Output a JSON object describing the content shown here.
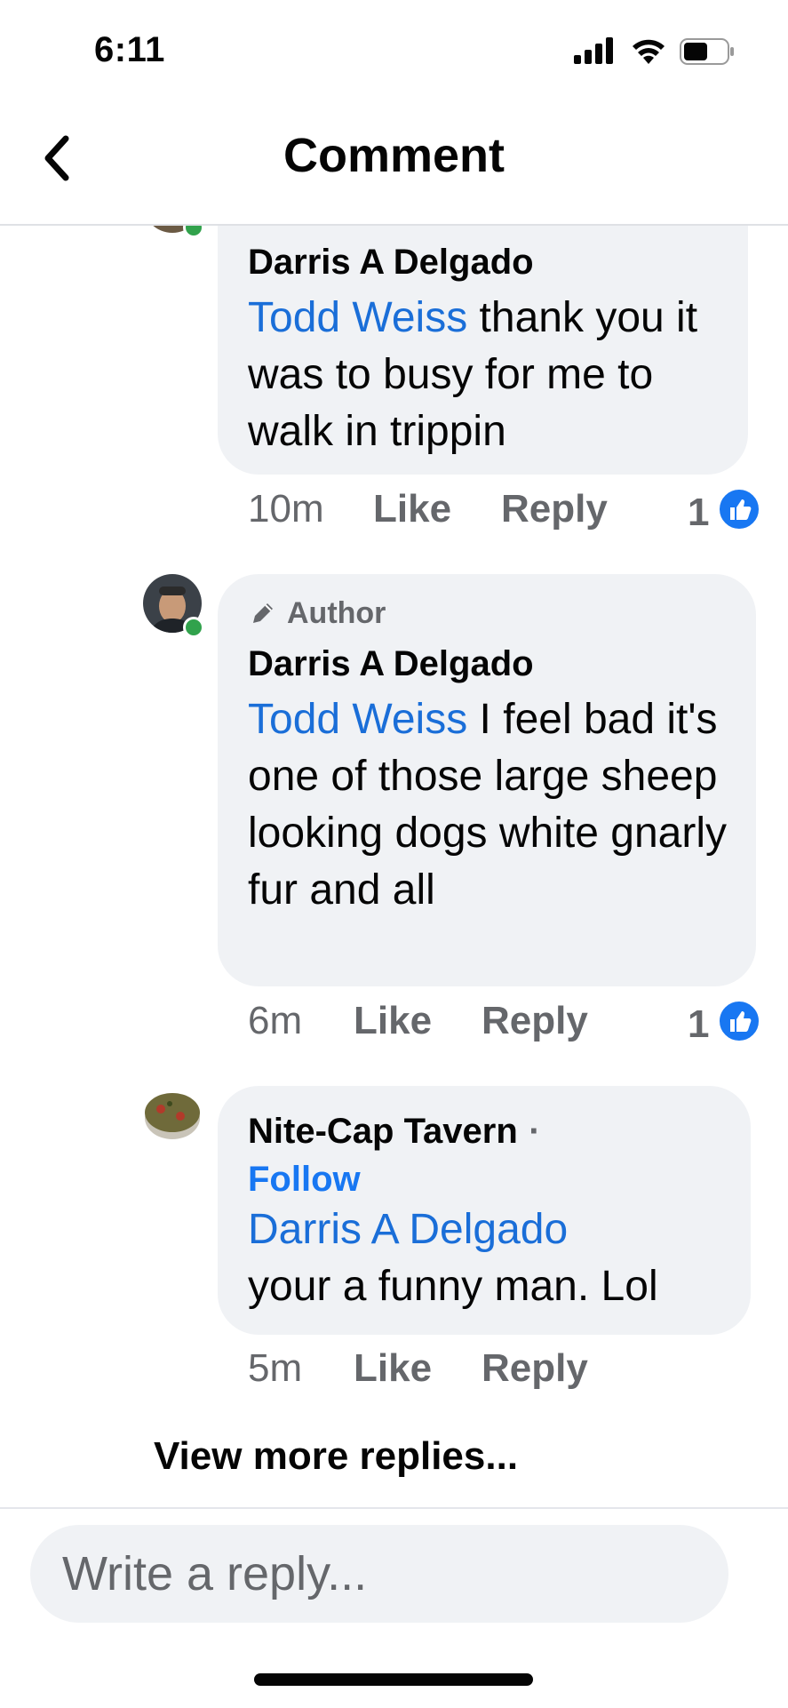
{
  "status_bar": {
    "time": "6:11",
    "icons": [
      "cellular-signal-icon",
      "wifi-icon",
      "battery-icon"
    ]
  },
  "header": {
    "title": "Comment",
    "back_icon": "chevron-left-icon"
  },
  "comments": [
    {
      "author": "Darris A Delgado",
      "mention": "Todd Weiss",
      "text": " thank you it was to busy for me to walk in trippin",
      "time": "10m",
      "like_label": "Like",
      "reply_label": "Reply",
      "like_count": "1"
    },
    {
      "badge": "Author",
      "author": "Darris A Delgado",
      "mention": "Todd Weiss",
      "text": " I feel bad it's one of those large sheep looking dogs white gnarly fur and all",
      "time": "6m",
      "like_label": "Like",
      "reply_label": "Reply",
      "like_count": "1"
    },
    {
      "author": "Nite-Cap Tavern",
      "separator": "·",
      "follow_label": "Follow",
      "mention": "Darris A Delgado",
      "text": "your a funny man. Lol",
      "time": "5m",
      "like_label": "Like",
      "reply_label": "Reply"
    }
  ],
  "view_more_label": "View more replies...",
  "reply_input": {
    "placeholder": "Write a reply..."
  },
  "colors": {
    "accent": "#1877f2",
    "mention": "#1a6ed8",
    "bubble": "#f0f2f5",
    "muted_text": "#65676b",
    "online": "#31a24c"
  }
}
